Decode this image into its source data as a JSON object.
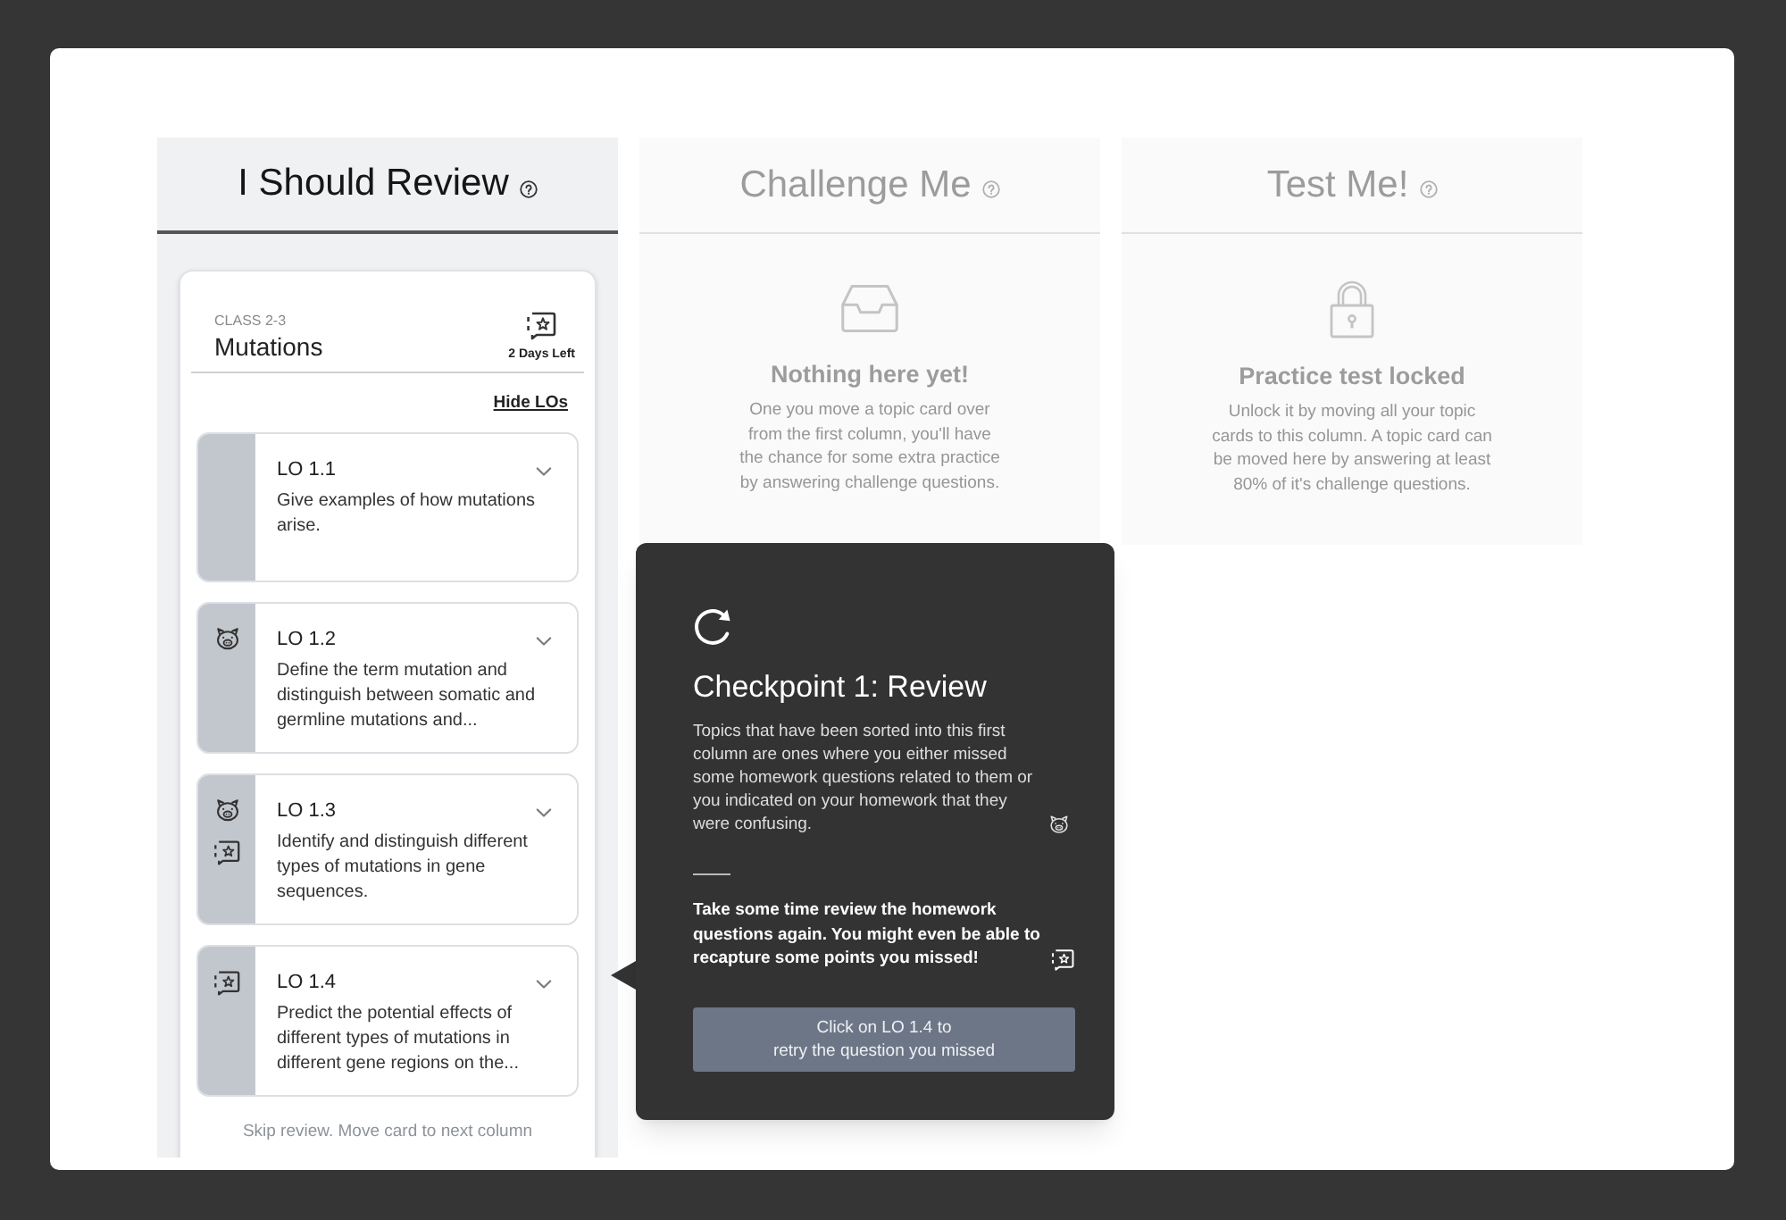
{
  "columns": [
    {
      "title": "I Should Review",
      "selected": true,
      "topic_card": {
        "class_label": "CLASS 2-3",
        "title": "Mutations",
        "due": "2 Days Left",
        "toggle_link": "Hide LOs",
        "los": [
          {
            "title": "LO 1.1",
            "description": "Give examples of how mutations arise.",
            "confusing": false,
            "missed": false,
            "expanded": false
          },
          {
            "title": "LO 1.2",
            "description": "Define the term mutation and distinguish between somatic and germline mutations and...",
            "confusing": true,
            "missed": false,
            "expanded": false
          },
          {
            "title": "LO 1.3",
            "description": "Identify and distinguish different types of mutations in gene sequences.",
            "confusing": true,
            "missed": true,
            "expanded": false
          },
          {
            "title": "LO 1.4",
            "description": "Predict the potential effects of different types of mutations in different gene regions on the...",
            "confusing": false,
            "missed": true,
            "expanded": false
          }
        ],
        "skip_link": "Skip review. Move card to next column"
      }
    },
    {
      "title": "Challenge Me",
      "selected": false,
      "empty_state": {
        "kind": "empty",
        "title": "Nothing here yet!",
        "lines": [
          "One you move a topic card over",
          "from the first column, you'll have",
          "the chance for some extra practice",
          "by answering challenge questions."
        ]
      }
    },
    {
      "title": "Test Me!",
      "selected": false,
      "empty_state": {
        "kind": "locked",
        "title": "Practice test locked",
        "lines": [
          "Unlock it by moving all your topic",
          "cards to this column. A topic card can",
          "be moved here by answering at least",
          "80% of it's challenge questions."
        ]
      }
    }
  ],
  "tooltip": {
    "title": "Checkpoint 1: Review",
    "body": "Topics that have been sorted into this first column are ones where you either missed some homework questions related to them or you indicated on your homework that they were confusing.",
    "note": "Take some time review the homework questions again. You might even be able to recapture some points you missed!",
    "button_lines": [
      "Click on LO 1.4 to",
      "retry the question you missed"
    ]
  }
}
